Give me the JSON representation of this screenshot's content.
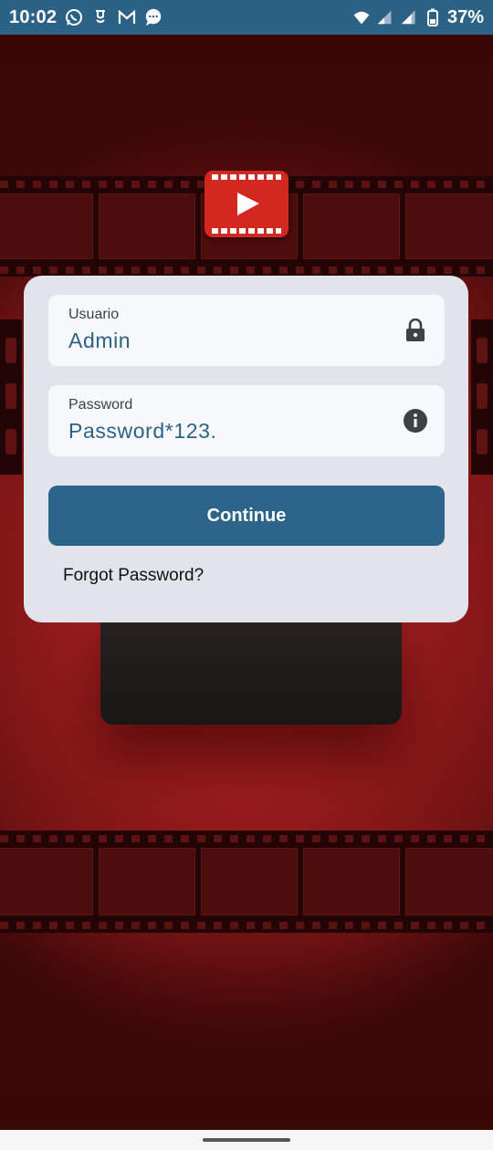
{
  "status_bar": {
    "time": "10:02",
    "battery_percent": "37%",
    "icons": [
      "whatsapp-icon",
      "bell-notification-icon",
      "gmail-icon",
      "chat-bubble-icon",
      "wifi-icon",
      "signal-icon",
      "signal-icon-2",
      "battery-icon"
    ]
  },
  "login": {
    "username": {
      "label": "Usuario",
      "value": "Admin",
      "icon": "lock-icon"
    },
    "password": {
      "label": "Password",
      "value": "Password*123.",
      "icon": "info-icon"
    },
    "continue_label": "Continue",
    "forgot_label": "Forgot Password?"
  },
  "logo": {
    "icon": "play-icon"
  },
  "colors": {
    "status_bar": "#2c6286",
    "primary_button": "#2c6589",
    "field_text": "#2c6286",
    "card_bg": "#e1e4ea",
    "logo_red": "#d2281f",
    "background_red": "#9a1c1d"
  }
}
